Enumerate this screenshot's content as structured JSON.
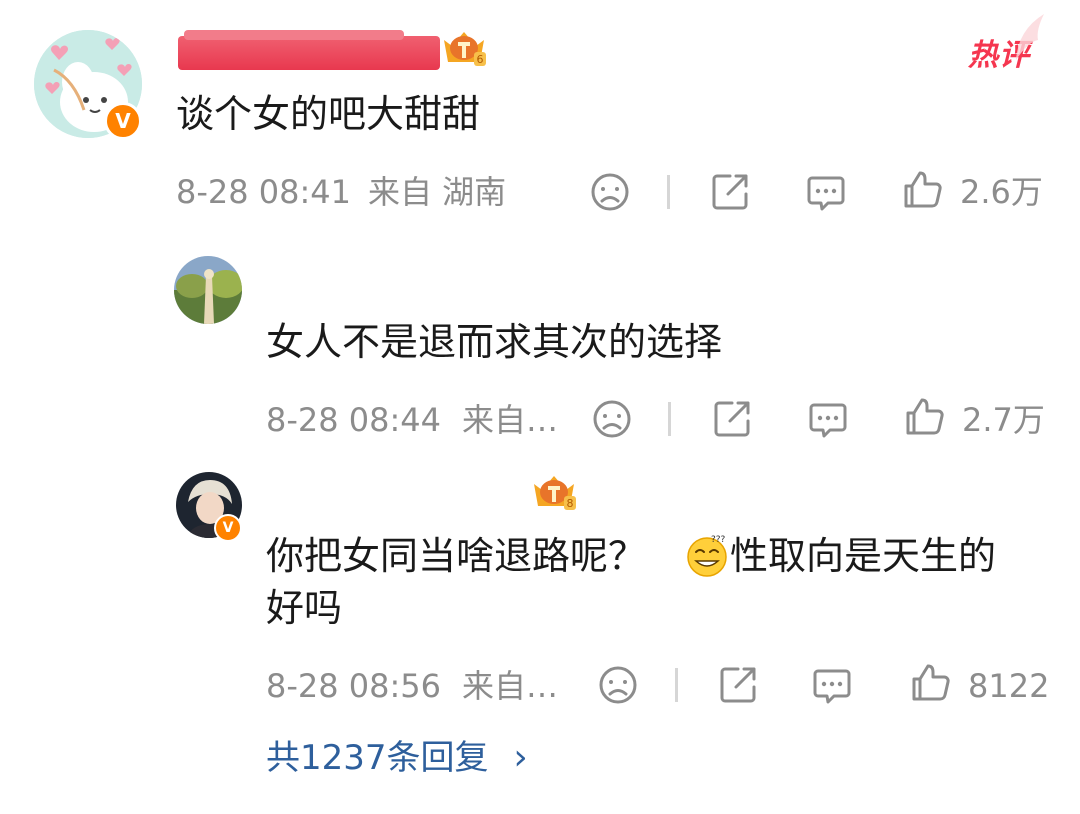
{
  "hot_label": "热评",
  "comment": {
    "text": "谈个女的吧大甜甜",
    "time": "8-28 08:41",
    "location": "来自 湖南",
    "likes": "2.6万"
  },
  "replies": [
    {
      "text": "女人不是退而求其次的选择",
      "time": "8-28 08:44",
      "location": "来自…",
      "likes": "2.7万"
    },
    {
      "text_line1_a": "你把女同当啥退路呢？",
      "text_line1_b": "性取向是天生的",
      "text_line2": "好吗",
      "time": "8-28 08:56",
      "location": "来自…",
      "likes": "8122"
    }
  ],
  "more_replies": "共1237条回复",
  "more_chevron": "›",
  "verified_badge": "V",
  "colors": {
    "accent_orange": "#ff8200",
    "hot_red": "#f5364f",
    "link_blue": "#2e5f9c",
    "meta_gray": "#8c8c8c"
  },
  "icons": [
    "dislike-face-icon",
    "share-icon",
    "comment-icon",
    "like-thumb-icon",
    "crown-badge-icon",
    "grin-emoji-icon"
  ]
}
